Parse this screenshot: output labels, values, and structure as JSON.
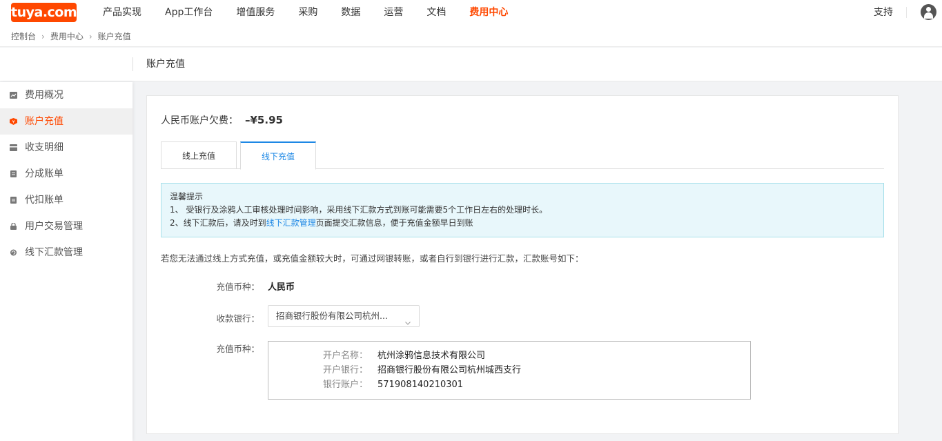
{
  "logo": {
    "text": "tuya.com"
  },
  "nav": [
    "产品实现",
    "App工作台",
    "增值服务",
    "采购",
    "数据",
    "运营",
    "文档",
    "费用中心"
  ],
  "nav_active": "费用中心",
  "header": {
    "support": "支持"
  },
  "breadcrumb": [
    "控制台",
    "费用中心",
    "账户充值"
  ],
  "page_title": "账户充值",
  "sidebar": {
    "items": [
      {
        "label": "费用概况",
        "icon": "chart-icon"
      },
      {
        "label": "账户充值",
        "icon": "wallet-icon",
        "active": true
      },
      {
        "label": "收支明细",
        "icon": "card-icon"
      },
      {
        "label": "分成账单",
        "icon": "bill-icon"
      },
      {
        "label": "代扣账单",
        "icon": "bill-icon"
      },
      {
        "label": "用户交易管理",
        "icon": "lock-icon"
      },
      {
        "label": "线下汇款管理",
        "icon": "refresh-icon"
      }
    ]
  },
  "account": {
    "owe_label": "人民币账户欠费：",
    "owe_amount": "–¥5.95"
  },
  "tabs": {
    "online": "线上充值",
    "offline": "线下充值"
  },
  "notice": {
    "title": "温馨提示",
    "line1": "1、 受银行及涂鸦人工审核处理时间影响，采用线下汇款方式到账可能需要5个工作日左右的处理时长。",
    "line2_prefix": "2、线下汇款后，请及时到",
    "line2_link": "线下汇款管理",
    "line2_suffix": "页面提交汇款信息，便于充值金额早日到账"
  },
  "hint": "若您无法通过线上方式充值，或充值金额较大时，可通过网银转账，或者自行到银行进行汇款，汇款账号如下：",
  "form": {
    "currency_label": "充值币种：",
    "currency_value": "人民币",
    "bank_label": "收款银行：",
    "bank_selected": "招商银行股份有限公司杭州...",
    "account_label": "充值币种："
  },
  "account_info": {
    "name_label": "开户名称：",
    "name_value": "杭州涂鸦信息技术有限公司",
    "bank_label": "开户银行：",
    "bank_value": "招商银行股份有限公司杭州城西支行",
    "number_label": "银行账户：",
    "number_value": "571908140210301"
  },
  "colors": {
    "brand": "#ff4800",
    "link": "#1e88e5",
    "notice_bg": "#e8f7fb"
  }
}
